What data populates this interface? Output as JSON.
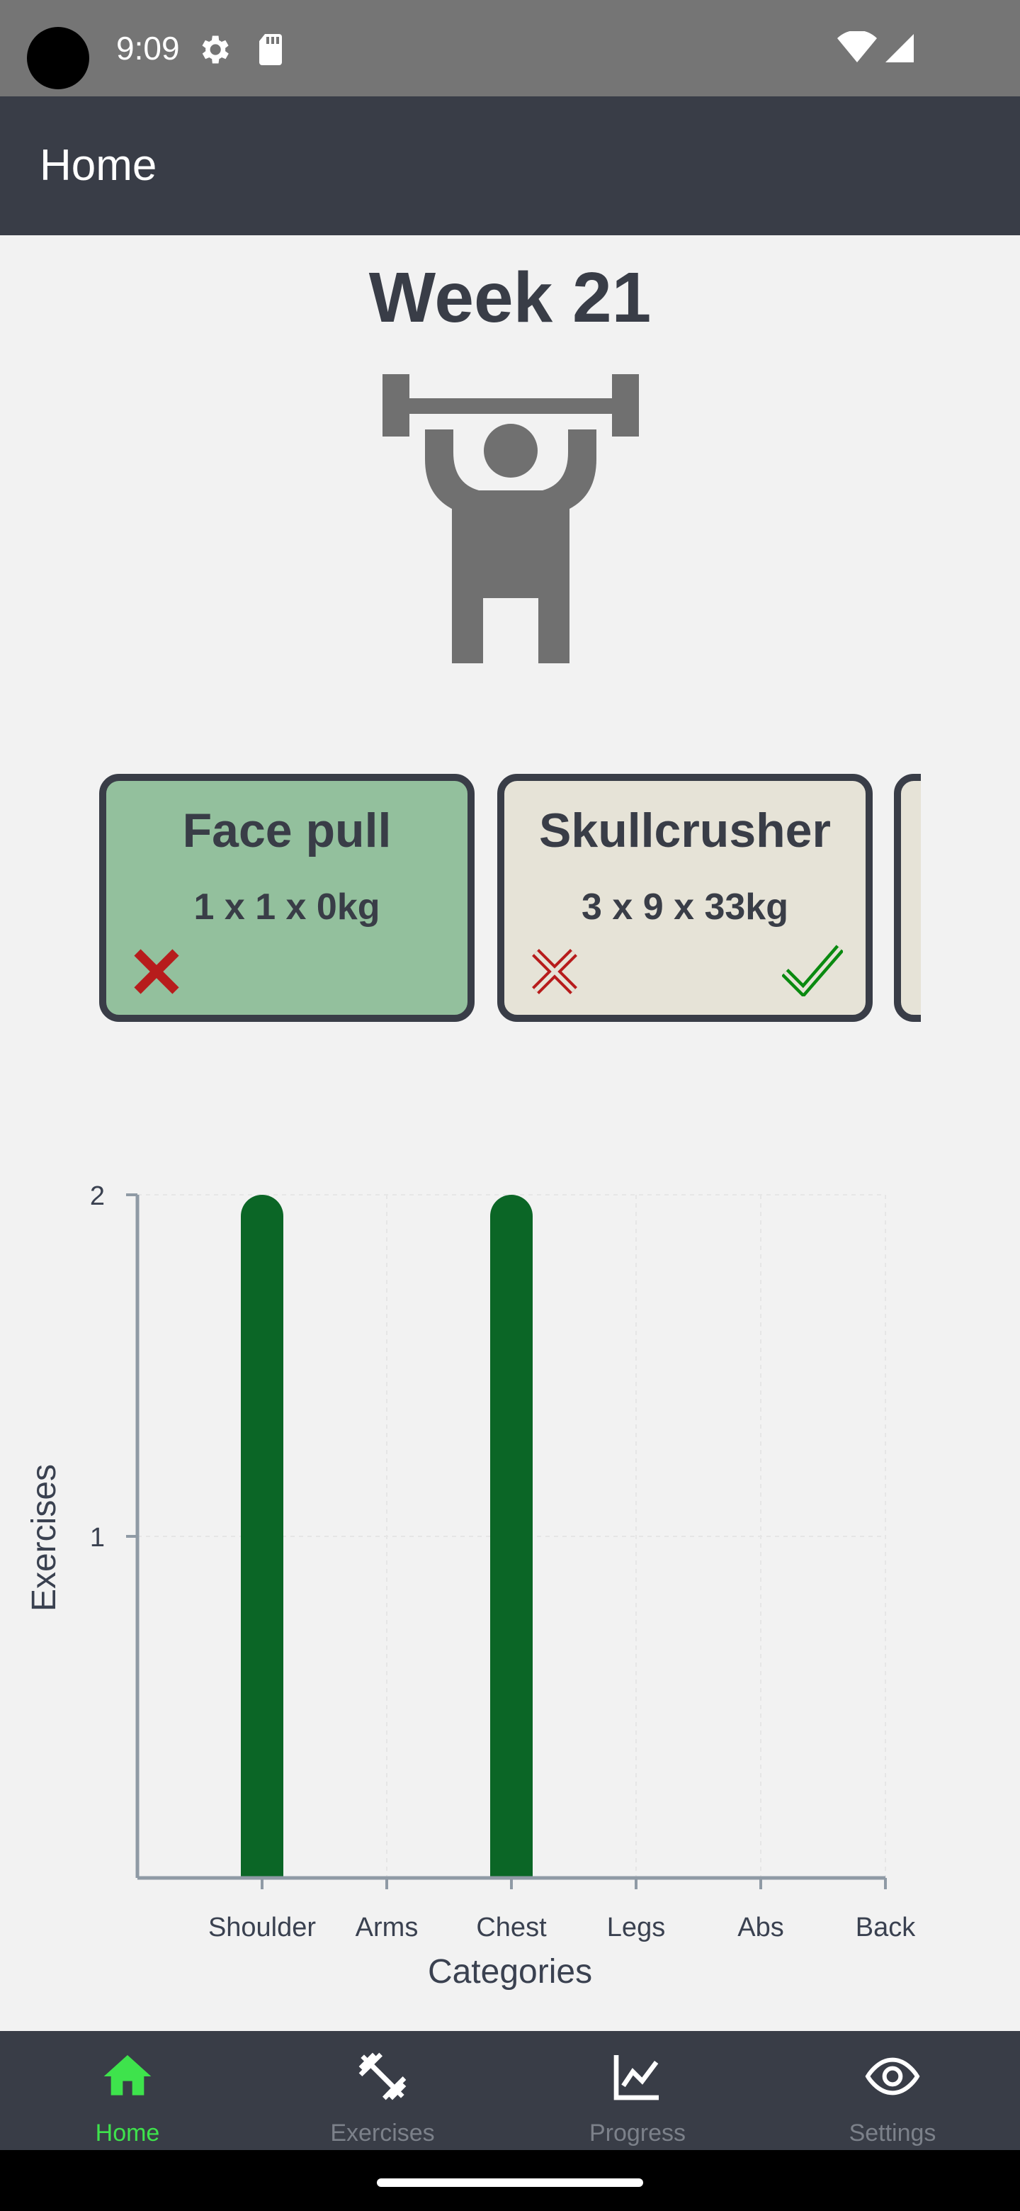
{
  "status_bar": {
    "time": "9:09"
  },
  "app_bar": {
    "title": "Home"
  },
  "week": {
    "title": "Week 21"
  },
  "cards": [
    {
      "name": "Face pull",
      "detail": "1 x 1 x 0kg",
      "completed": true
    },
    {
      "name": "Skullcrusher",
      "detail": "3 x 9 x 33kg",
      "completed": false
    }
  ],
  "chart_data": {
    "type": "bar",
    "categories": [
      "Shoulder",
      "Arms",
      "Chest",
      "Legs",
      "Abs",
      "Back"
    ],
    "values": [
      2,
      0,
      2,
      0,
      0,
      0
    ],
    "xlabel": "Categories",
    "ylabel": "Exercises",
    "ylim": [
      0,
      2
    ],
    "yticks": [
      1,
      2
    ],
    "grid": true,
    "bar_color": "#0b6626"
  },
  "bottom_nav": {
    "items": [
      {
        "label": "Home",
        "icon": "home-icon",
        "active": true
      },
      {
        "label": "Exercises",
        "icon": "dumbbell-icon",
        "active": false
      },
      {
        "label": "Progress",
        "icon": "chart-line-icon",
        "active": false
      },
      {
        "label": "Settings",
        "icon": "eye-icon",
        "active": false
      }
    ]
  },
  "colors": {
    "app_bar": "#393d47",
    "background": "#f2f2f2",
    "active_nav": "#3ee34c",
    "completed_card": "#93c09d",
    "pending_card": "#e6e3d7",
    "delete": "#b71c1c",
    "done": "#0a8a10"
  }
}
